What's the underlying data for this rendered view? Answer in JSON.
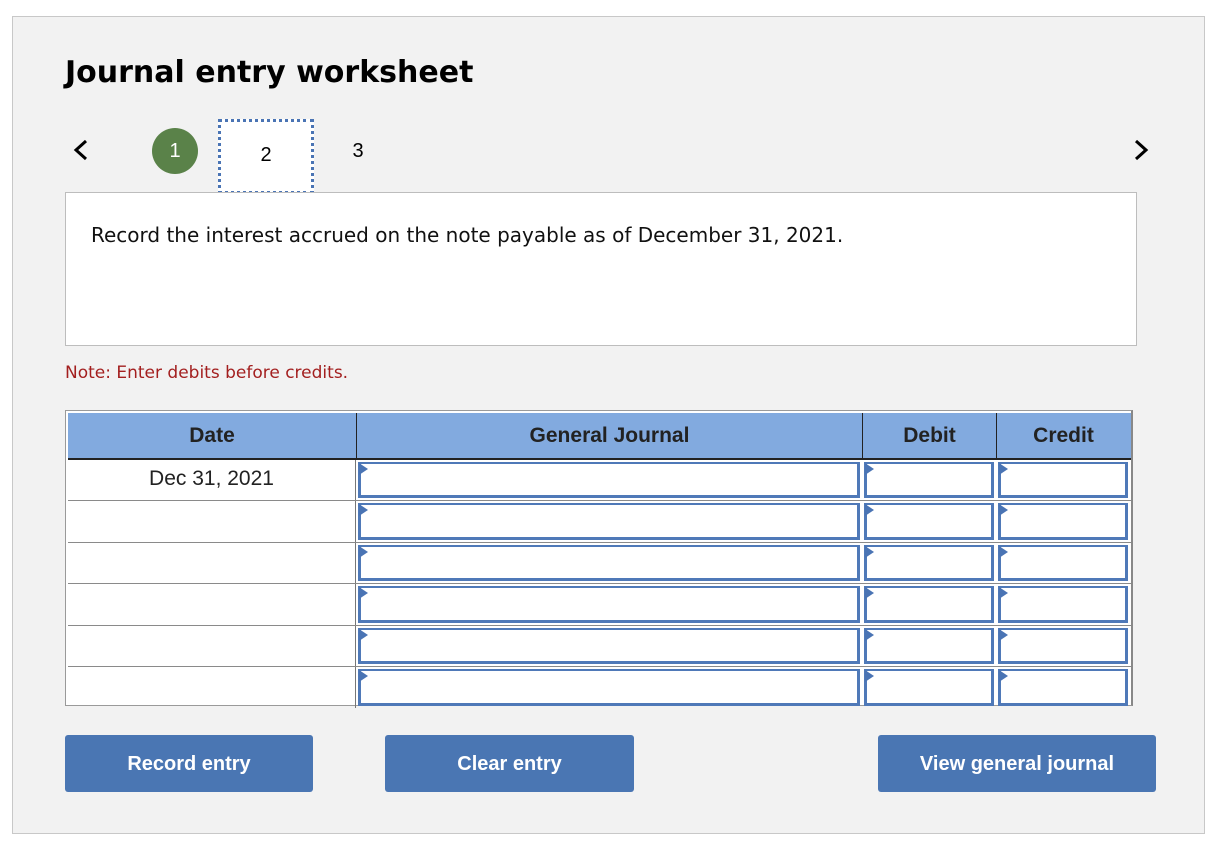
{
  "title": "Journal entry worksheet",
  "navigation": {
    "prev_icon": "chevron-left-icon",
    "next_icon": "chevron-right-icon",
    "steps": [
      {
        "label": "1",
        "state": "completed"
      },
      {
        "label": "2",
        "state": "current"
      },
      {
        "label": "3",
        "state": "pending"
      }
    ]
  },
  "prompt": "Record the interest accrued on the note payable as of December 31, 2021.",
  "note": "Note: Enter debits before credits.",
  "table": {
    "headers": {
      "date": "Date",
      "general_journal": "General Journal",
      "debit": "Debit",
      "credit": "Credit"
    },
    "rows": [
      {
        "date": "Dec 31, 2021",
        "account": "",
        "debit": "",
        "credit": ""
      },
      {
        "date": "",
        "account": "",
        "debit": "",
        "credit": ""
      },
      {
        "date": "",
        "account": "",
        "debit": "",
        "credit": ""
      },
      {
        "date": "",
        "account": "",
        "debit": "",
        "credit": ""
      },
      {
        "date": "",
        "account": "",
        "debit": "",
        "credit": ""
      },
      {
        "date": "",
        "account": "",
        "debit": "",
        "credit": ""
      }
    ]
  },
  "buttons": {
    "record": "Record entry",
    "clear": "Clear entry",
    "view": "View general journal"
  },
  "colors": {
    "step_completed": "#5a8249",
    "header_bg": "#82aadf",
    "button_bg": "#4a76b3",
    "note_text": "#a31f1f"
  }
}
